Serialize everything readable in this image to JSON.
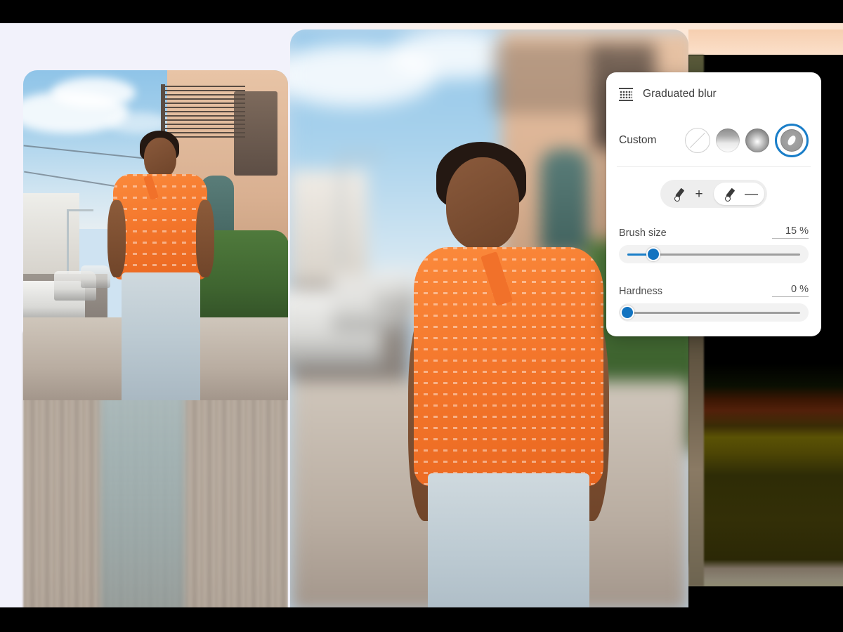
{
  "app": {
    "canvas_background": "#000000",
    "accent_color": "#1a7ec8"
  },
  "photos": {
    "left": {
      "name": "original-photo-thumbnail",
      "description": "Sharp original photo: man in orange polo shirt on a sunny city sidewalk"
    },
    "right": {
      "name": "blurred-photo-preview",
      "description": "Same photo with graduated blur applied to the background"
    }
  },
  "panel": {
    "title": "Graduated blur",
    "title_icon": "dither-grid-icon",
    "custom": {
      "label": "Custom",
      "presets": [
        {
          "id": "none",
          "icon": "no-blur-circle-icon",
          "selected": false
        },
        {
          "id": "linear",
          "icon": "linear-gradient-circle-icon",
          "selected": false
        },
        {
          "id": "radial",
          "icon": "radial-gradient-circle-icon",
          "selected": false
        },
        {
          "id": "custom",
          "icon": "custom-ellipse-circle-icon",
          "selected": true
        }
      ]
    },
    "brush_tools": [
      {
        "id": "brush-add",
        "brush_icon": "brush-icon",
        "sign_icon": "plus-icon",
        "sign": "+",
        "selected": false
      },
      {
        "id": "brush-subtract",
        "brush_icon": "brush-icon",
        "sign_icon": "minus-icon",
        "sign": "—",
        "selected": true
      }
    ],
    "sliders": [
      {
        "id": "brush-size",
        "label": "Brush size",
        "value": "15 %",
        "percent": 15
      },
      {
        "id": "hardness",
        "label": "Hardness",
        "value": "0 %",
        "percent": 0
      }
    ]
  }
}
